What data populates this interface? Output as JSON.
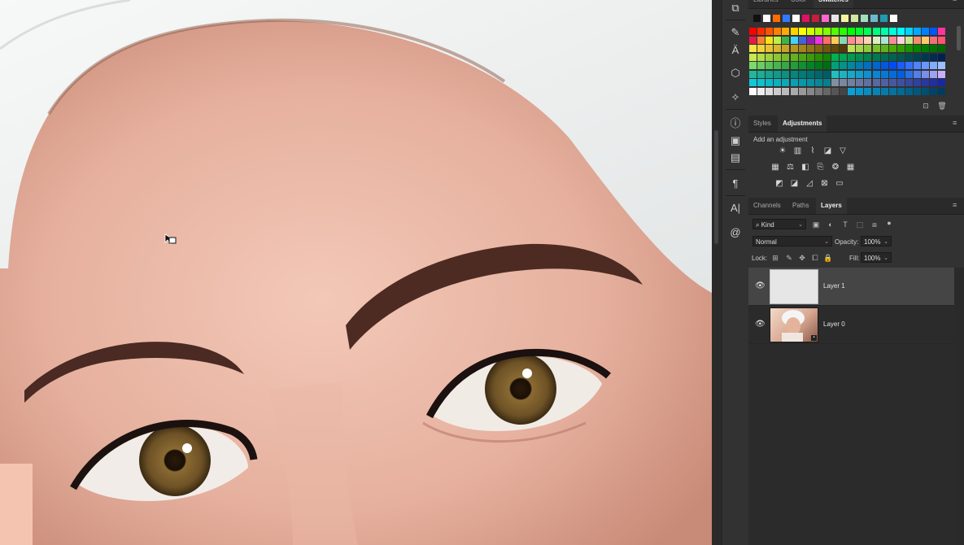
{
  "colors": {
    "panel_bg": "#323232",
    "tab_bg": "#2a2a2a",
    "selected_layer": "#454545",
    "skin": "#e8b3a2",
    "towel": "#f1f2f2",
    "iris": "#7a5a2a"
  },
  "swatches_panel": {
    "tabs": [
      "Libraries",
      "Color",
      "Swatches"
    ],
    "active_tab": "Swatches",
    "grid_rows": [
      [
        "#ff0000",
        "#ff2a00",
        "#ff5500",
        "#ff8000",
        "#ffaa00",
        "#ffd400",
        "#ffff00",
        "#d4ff00",
        "#aaff00",
        "#80ff00",
        "#55ff00",
        "#2aff00",
        "#00ff00",
        "#00ff2a",
        "#00ff55",
        "#00ff80",
        "#00ffaa",
        "#00ffd4",
        "#00ffff",
        "#00d4ff",
        "#00aaff",
        "#0080ff",
        "#0055ff",
        "#ff3399"
      ],
      [
        "#e6194b",
        "#f58231",
        "#ffe119",
        "#bfef45",
        "#3cb44b",
        "#42d4f4",
        "#4363d8",
        "#911eb4",
        "#f032e6",
        "#ff6f61",
        "#ffcc5c",
        "#88d8b0",
        "#ff8c94",
        "#ffaaa6",
        "#ffd3b5",
        "#dcedc1",
        "#a8e6cf",
        "#ff8b94",
        "#ffd1dc",
        "#c3e88d",
        "#f78c6c",
        "#ffcb6b",
        "#f07178",
        "#ff5370"
      ],
      [
        "#f5e642",
        "#f2d43a",
        "#e8c32f",
        "#d9b62a",
        "#c4a625",
        "#b39520",
        "#a3851b",
        "#927616",
        "#826612",
        "#72570e",
        "#62480a",
        "#523a07",
        "#c0e05a",
        "#a8d54a",
        "#90ca3a",
        "#78bf2a",
        "#60b41a",
        "#48a90a",
        "#309e00",
        "#189300",
        "#008800",
        "#007d00",
        "#007200",
        "#006700"
      ],
      [
        "#c7e84f",
        "#b3dd45",
        "#9fd23b",
        "#8bc731",
        "#77bc27",
        "#63b11d",
        "#4fa613",
        "#3b9b09",
        "#279000",
        "#138500",
        "#00b050",
        "#00a550",
        "#009a50",
        "#008f50",
        "#008450",
        "#007950",
        "#006e50",
        "#006350",
        "#005850",
        "#004d50",
        "#004250",
        "#003750",
        "#002c50",
        "#002150"
      ],
      [
        "#7cd96c",
        "#6acd62",
        "#58c158",
        "#46b54e",
        "#34a944",
        "#229d3a",
        "#109130",
        "#008526",
        "#00791c",
        "#006d12",
        "#00a078",
        "#00948a",
        "#00889c",
        "#007cae",
        "#0070c0",
        "#0064d2",
        "#0058e4",
        "#004cf6",
        "#1a5cff",
        "#3470ff",
        "#4e84ff",
        "#6898ff",
        "#82acff",
        "#9cc0ff"
      ],
      [
        "#1fb89a",
        "#1aae94",
        "#15a48e",
        "#109a88",
        "#0b9082",
        "#06867c",
        "#017c76",
        "#007270",
        "#00686a",
        "#005e64",
        "#20c0c0",
        "#1cb4c4",
        "#18a8c8",
        "#149ccc",
        "#1090d0",
        "#0c84d4",
        "#0878d8",
        "#046cdc",
        "#0060e0",
        "#2870e4",
        "#5080e8",
        "#7890ec",
        "#a0a0f0",
        "#c8b0f4"
      ],
      [
        "#0fc8d8",
        "#0ec0d0",
        "#0db8c8",
        "#0cb0c0",
        "#0ba8b8",
        "#0aa0b0",
        "#0998a8",
        "#0890a0",
        "#078898",
        "#068090",
        "#8090a0",
        "#7888a0",
        "#7080a0",
        "#6878a0",
        "#6070a0",
        "#5868a0",
        "#5060a0",
        "#4858a0",
        "#4050a0",
        "#3848a0",
        "#3040a0",
        "#2838a0",
        "#2030a0",
        "#1828a0"
      ],
      [
        "#ffffff",
        "#eeeeee",
        "#dddddd",
        "#cccccc",
        "#bbbbbb",
        "#aaaaaa",
        "#999999",
        "#888888",
        "#777777",
        "#666666",
        "#555555",
        "#444444",
        "#0a9fd6",
        "#0996cb",
        "#088dc0",
        "#0784b5",
        "#067baa",
        "#05729f",
        "#046994",
        "#036089",
        "#02577e",
        "#014e73",
        "#004568",
        "#003c5d"
      ]
    ],
    "recent_row": [
      "#111111",
      "#ffffff",
      "#ff6b00",
      "#2f7bff",
      "#ffffff",
      "#e0115f",
      "#c41e3a",
      "#ff66cc",
      "#e6e6e6",
      "#f5f5a0",
      "#d0e8a0",
      "#a0e0c0",
      "#66bbcc",
      "#1f9ab0",
      "#ffffff"
    ]
  },
  "adjustments_panel": {
    "tabs": [
      "Styles",
      "Adjustments"
    ],
    "active_tab": "Adjustments",
    "heading": "Add an adjustment",
    "icons_row1": [
      "brightness-contrast-icon",
      "levels-icon",
      "curves-icon",
      "exposure-icon",
      "vibrance-icon"
    ],
    "icons_row2": [
      "hue-saturation-icon",
      "color-balance-icon",
      "black-white-icon",
      "photo-filter-icon",
      "channel-mixer-icon",
      "color-lookup-icon"
    ],
    "icons_row3": [
      "invert-icon",
      "posterize-icon",
      "threshold-icon",
      "selective-color-icon",
      "gradient-map-icon"
    ]
  },
  "layers_panel": {
    "tabs": [
      "Channels",
      "Paths",
      "Layers"
    ],
    "active_tab": "Layers",
    "filter_kind": "Kind",
    "blend_mode": "Normal",
    "opacity_label": "Opacity:",
    "opacity_value": "100%",
    "lock_label": "Lock:",
    "fill_label": "Fill:",
    "fill_value": "100%",
    "layers": [
      {
        "name": "Layer 1",
        "selected": true,
        "visible": true
      },
      {
        "name": "Layer 0",
        "selected": false,
        "visible": true
      }
    ]
  },
  "glyphs": {
    "eye": "👁",
    "menu": "≡",
    "chevron": "⌄",
    "pilcrow": "¶",
    "info": "ⓘ",
    "search": "⌕",
    "text_tool": "T"
  }
}
